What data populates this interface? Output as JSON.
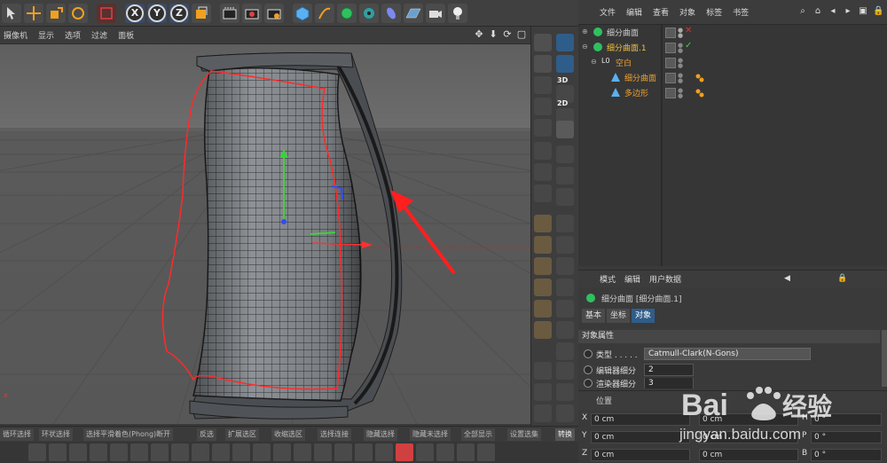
{
  "viewport_menu": {
    "items": [
      "摄像机",
      "显示",
      "选项",
      "过滤",
      "面板"
    ]
  },
  "toolbar": {
    "axis_x": "X",
    "axis_y": "Y",
    "axis_z": "Z"
  },
  "tool_strip": {
    "label_3d": "3D",
    "label_2d": "2D"
  },
  "object_manager": {
    "menu": [
      "文件",
      "编辑",
      "查看",
      "对象",
      "标签",
      "书签"
    ],
    "objects": [
      {
        "name": "细分曲面",
        "color": "#d0d0d0",
        "indent": 0
      },
      {
        "name": "细分曲面.1",
        "color": "#f0c040",
        "indent": 0
      },
      {
        "name": "空白",
        "color": "#f0a030",
        "indent": 1
      },
      {
        "name": "细分曲面",
        "color": "#f0a030",
        "indent": 2
      },
      {
        "name": "多边形",
        "color": "#f0a030",
        "indent": 2
      }
    ],
    "null_icon_label": "L0"
  },
  "attribute_manager": {
    "menu": [
      "模式",
      "编辑",
      "用户数据"
    ],
    "title": "细分曲面 [细分曲面.1]",
    "tabs": [
      "基本",
      "坐标",
      "对象"
    ],
    "active_tab": "对象",
    "section": "对象属性",
    "props": [
      {
        "label": "类型 . . . . .",
        "value": "Catmull-Clark(N-Gons)"
      },
      {
        "label": "编辑器细分",
        "value": "2"
      },
      {
        "label": "渲染器细分",
        "value": "3"
      }
    ]
  },
  "coordinates": {
    "header": "位置",
    "rows": [
      {
        "axis": "X",
        "pos": "0 cm",
        "size": "0 cm",
        "rot_axis": "H",
        "rot": "0 °"
      },
      {
        "axis": "Y",
        "pos": "0 cm",
        "size": "0 cm",
        "rot_axis": "P",
        "rot": "0 °"
      },
      {
        "axis": "Z",
        "pos": "0 cm",
        "size": "0 cm",
        "rot_axis": "B",
        "rot": "0 °"
      }
    ]
  },
  "selection_bar": {
    "items": [
      "循环选择",
      "环状选择",
      "选择平滑着色(Phong)断开",
      "反选",
      "扩展选区",
      "收缩选区",
      "选择连接",
      "隐藏选择",
      "隐藏未选择",
      "全部显示",
      "设置选集",
      "转换"
    ]
  },
  "watermark": {
    "brand": "Baidu经验",
    "url": "jingyan.baidu.com"
  },
  "colors": {
    "accent_blue": "#2f5d8a",
    "selection_red": "#ff2a2a",
    "axis_green": "#3fcf3f",
    "axis_blue": "#2f4cff"
  }
}
